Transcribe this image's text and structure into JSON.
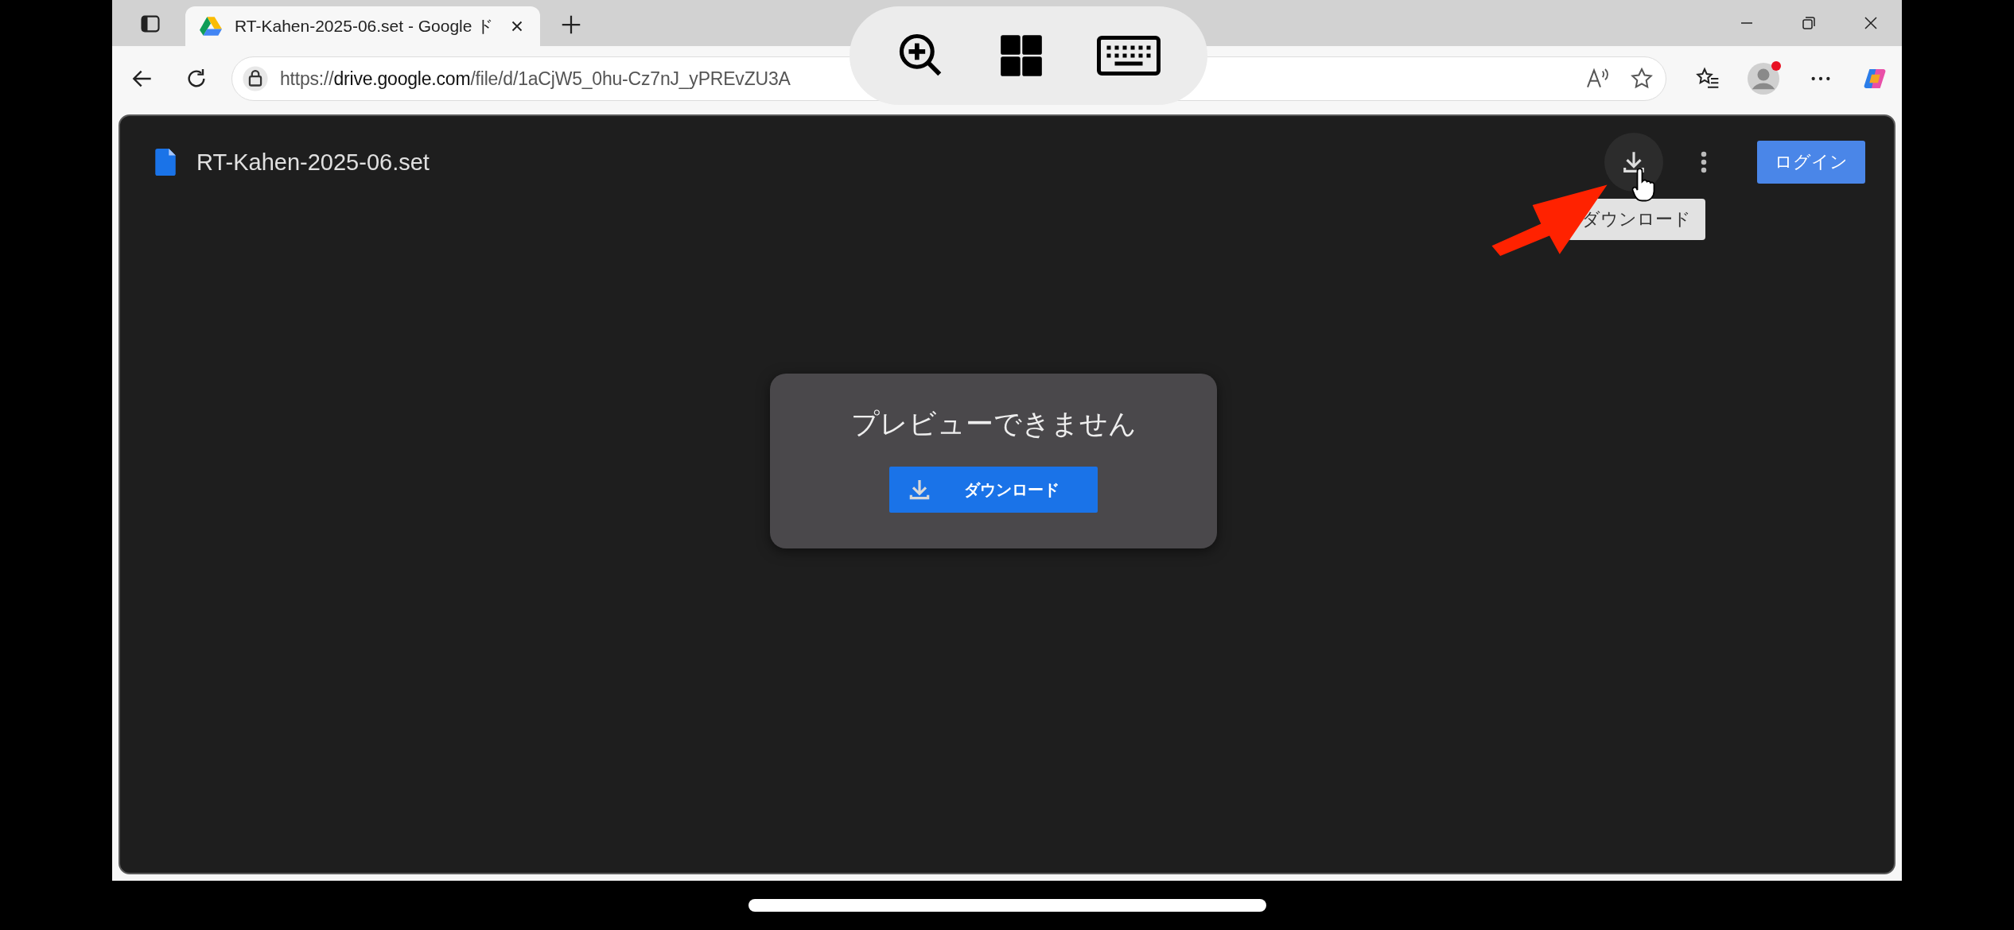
{
  "browser": {
    "tab": {
      "title": "RT-Kahen-2025-06.set - Google ド"
    },
    "url": {
      "scheme": "https://",
      "host": "drive.google.com",
      "path": "/file/d/1aCjW5_0hu-Cz7nJ_yPREvZU3A"
    },
    "profile": {
      "notification": true
    }
  },
  "viewer": {
    "file_name": "RT-Kahen-2025-06.set",
    "download_tooltip": "ダウンロード",
    "login_button": "ログイン"
  },
  "preview_card": {
    "message": "プレビューできません",
    "download_button": "ダウンロード"
  }
}
